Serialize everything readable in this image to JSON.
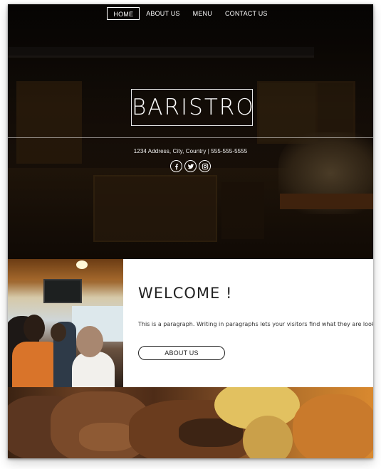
{
  "nav": {
    "items": [
      {
        "label": "HOME",
        "active": true
      },
      {
        "label": "ABOUT US",
        "active": false
      },
      {
        "label": "MENU",
        "active": false
      },
      {
        "label": "CONTACT US",
        "active": false
      }
    ]
  },
  "hero": {
    "brand": "BARISTRO",
    "address": "1234 Address, City, Country | 555-555-5555",
    "socials": [
      "facebook-icon",
      "twitter-icon",
      "instagram-icon"
    ]
  },
  "welcome": {
    "title": "WELCOME !",
    "paragraph": "This is a paragraph. Writing in paragraphs lets your visitors find what they are looking for quickly",
    "button_label": "ABOUT US"
  },
  "colors": {
    "text_dark": "#222222",
    "white": "#ffffff",
    "hero_overlay": "#0b0704"
  }
}
